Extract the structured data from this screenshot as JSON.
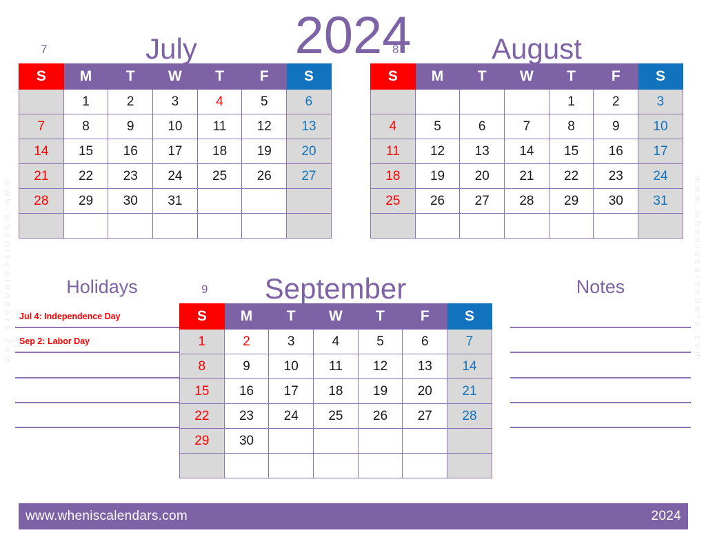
{
  "document": {
    "year_title": "2024",
    "watermark": "www.wheniscalendars.com"
  },
  "colors": {
    "purple": "#7d62a6",
    "grid_border": "#8e73b5",
    "sunday_red": "#fc0000",
    "saturday_blue": "#1173bd",
    "weekend_cell_gray": "#d9d9d9",
    "text_black": "#1a1a1a",
    "page_background": "#ffffff"
  },
  "weekday_headers": [
    "S",
    "M",
    "T",
    "W",
    "T",
    "F",
    "S"
  ],
  "months": [
    {
      "number": "7",
      "name": "July",
      "weeks": [
        [
          "",
          "1",
          "2",
          "3",
          "4",
          "5",
          "6"
        ],
        [
          "7",
          "8",
          "9",
          "10",
          "11",
          "12",
          "13"
        ],
        [
          "14",
          "15",
          "16",
          "17",
          "18",
          "19",
          "20"
        ],
        [
          "21",
          "22",
          "23",
          "24",
          "25",
          "26",
          "27"
        ],
        [
          "28",
          "29",
          "30",
          "31",
          "",
          "",
          ""
        ],
        [
          "",
          "",
          "",
          "",
          "",
          "",
          ""
        ]
      ],
      "holiday_cells": [
        [
          0,
          4
        ]
      ]
    },
    {
      "number": "8",
      "name": "August",
      "weeks": [
        [
          "",
          "",
          "",
          "",
          "1",
          "2",
          "3"
        ],
        [
          "4",
          "5",
          "6",
          "7",
          "8",
          "9",
          "10"
        ],
        [
          "11",
          "12",
          "13",
          "14",
          "15",
          "16",
          "17"
        ],
        [
          "18",
          "19",
          "20",
          "21",
          "22",
          "23",
          "24"
        ],
        [
          "25",
          "26",
          "27",
          "28",
          "29",
          "30",
          "31"
        ],
        [
          "",
          "",
          "",
          "",
          "",
          "",
          ""
        ]
      ],
      "holiday_cells": []
    },
    {
      "number": "9",
      "name": "September",
      "weeks": [
        [
          "1",
          "2",
          "3",
          "4",
          "5",
          "6",
          "7"
        ],
        [
          "8",
          "9",
          "10",
          "11",
          "12",
          "13",
          "14"
        ],
        [
          "15",
          "16",
          "17",
          "18",
          "19",
          "20",
          "21"
        ],
        [
          "22",
          "23",
          "24",
          "25",
          "26",
          "27",
          "28"
        ],
        [
          "29",
          "30",
          "",
          "",
          "",
          "",
          ""
        ],
        [
          "",
          "",
          "",
          "",
          "",
          "",
          ""
        ]
      ],
      "holiday_cells": [
        [
          0,
          1
        ]
      ]
    }
  ],
  "holidays_panel": {
    "title": "Holidays",
    "entries": [
      "Jul 4: Independence Day",
      "Sep 2: Labor Day",
      "",
      "",
      "",
      ""
    ]
  },
  "notes_panel": {
    "title": "Notes",
    "entries": [
      "",
      "",
      "",
      "",
      "",
      ""
    ]
  },
  "footer": {
    "website": "www.wheniscalendars.com",
    "year": "2024"
  }
}
